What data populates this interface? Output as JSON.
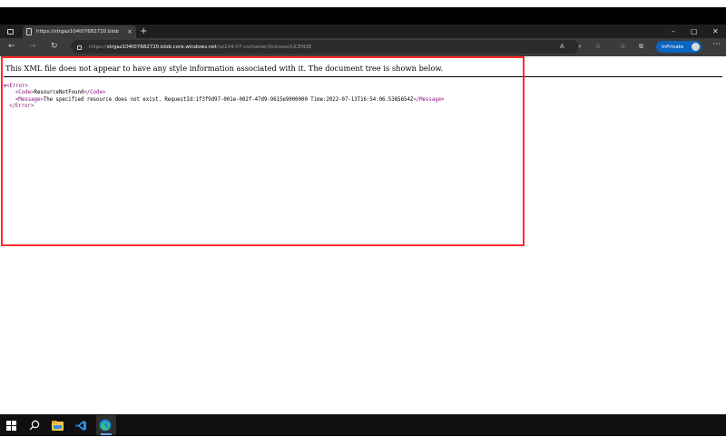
{
  "browser": {
    "tab_title": "https://strgaz104t07682720.blob",
    "tab_close": "×",
    "new_tab": "+",
    "window_controls": {
      "minimize": "–",
      "maximize": "▢",
      "close": "✕"
    },
    "nav": {
      "back": "←",
      "forward": "→",
      "refresh": "↻"
    },
    "url": {
      "scheme": "https://",
      "host": "strgaz104t07682720.blob.core.windows.net",
      "path": "/az104-07-container/licenses/LICENSE"
    },
    "toolbar_icons": [
      "A",
      "⌕",
      "☆",
      "☆",
      "⧉"
    ],
    "inprivate_label": "InPrivate",
    "more": "⋯"
  },
  "page": {
    "info_message": "This XML file does not appear to have any style information associated with it. The document tree is shown below.",
    "xml": {
      "toggle": "▼",
      "root_open": "<Error>",
      "code_open": "<Code>",
      "code_value": "ResourceNotFound",
      "code_close": "</Code>",
      "message_open": "<Message>",
      "message_value": "The specified resource does not exist. RequestId:1f3f9d97-001e-002f-47d9-9615e9000000 Time:2022-07-13T16:54:06.5385654Z",
      "message_close": "</Message>",
      "root_close": "</Error>"
    }
  },
  "taskbar": {
    "items": [
      "windows-start",
      "search",
      "file-explorer",
      "vscode",
      "edge"
    ]
  },
  "colors": {
    "xml_tag": "#881280",
    "highlight_box": "#ff2a2a",
    "inprivate": "#0a64c0"
  }
}
